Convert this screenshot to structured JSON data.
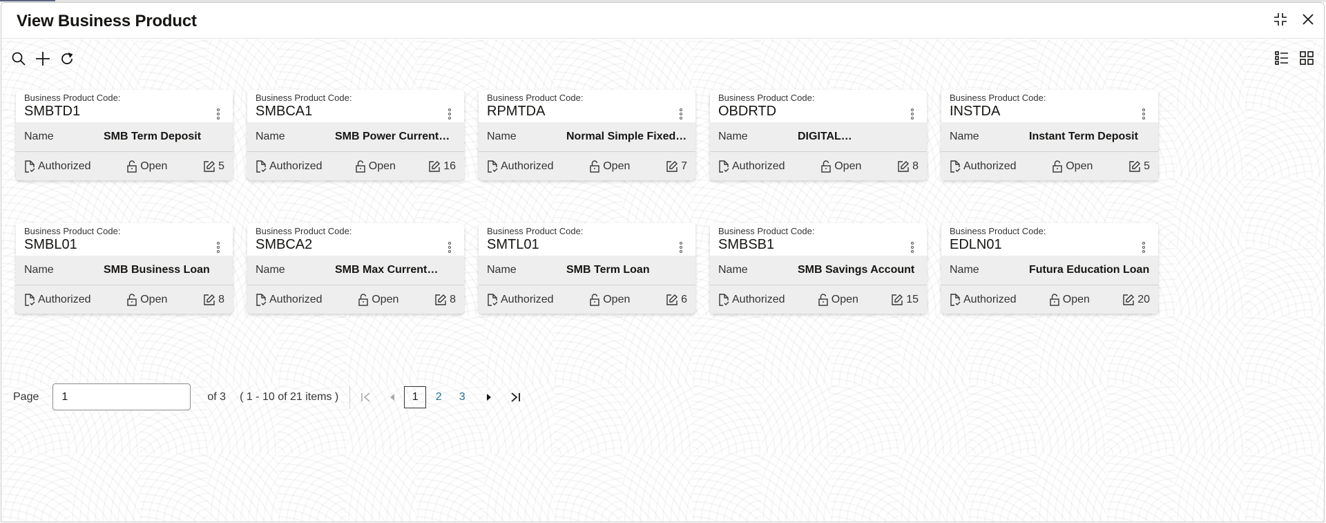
{
  "window": {
    "title": "View Business Product",
    "header_icons": [
      "minimize-icon",
      "close-icon"
    ]
  },
  "toolbar": {
    "icons": [
      "search-icon",
      "add-icon",
      "refresh-icon"
    ],
    "view_icons": [
      "list-view-icon",
      "tile-view-icon"
    ]
  },
  "cards": [
    {
      "code_label": "Business Product Code:",
      "code": "SMBTD1",
      "name_label": "Name",
      "name": "SMB Term Deposit",
      "auth_status": "Authorized",
      "record_status": "Open",
      "mod_count": "5"
    },
    {
      "code_label": "Business Product Code:",
      "code": "SMBCA1",
      "name_label": "Name",
      "name": "SMB Power Current…",
      "auth_status": "Authorized",
      "record_status": "Open",
      "mod_count": "16"
    },
    {
      "code_label": "Business Product Code:",
      "code": "RPMTDA",
      "name_label": "Name",
      "name": "Normal Simple Fixed…",
      "auth_status": "Authorized",
      "record_status": "Open",
      "mod_count": "7"
    },
    {
      "code_label": "Business Product Code:",
      "code": "OBDRTD",
      "name_label": "Name",
      "name": "DIGITAL…",
      "auth_status": "Authorized",
      "record_status": "Open",
      "mod_count": "8"
    },
    {
      "code_label": "Business Product Code:",
      "code": "INSTDA",
      "name_label": "Name",
      "name": "Instant Term Deposit",
      "auth_status": "Authorized",
      "record_status": "Open",
      "mod_count": "5"
    },
    {
      "code_label": "Business Product Code:",
      "code": "SMBL01",
      "name_label": "Name",
      "name": "SMB Business Loan",
      "auth_status": "Authorized",
      "record_status": "Open",
      "mod_count": "8"
    },
    {
      "code_label": "Business Product Code:",
      "code": "SMBCA2",
      "name_label": "Name",
      "name": "SMB Max Current…",
      "auth_status": "Authorized",
      "record_status": "Open",
      "mod_count": "8"
    },
    {
      "code_label": "Business Product Code:",
      "code": "SMTL01",
      "name_label": "Name",
      "name": "SMB Term Loan",
      "auth_status": "Authorized",
      "record_status": "Open",
      "mod_count": "6"
    },
    {
      "code_label": "Business Product Code:",
      "code": "SMBSB1",
      "name_label": "Name",
      "name": "SMB Savings Account",
      "auth_status": "Authorized",
      "record_status": "Open",
      "mod_count": "15"
    },
    {
      "code_label": "Business Product Code:",
      "code": "EDLN01",
      "name_label": "Name",
      "name": "Futura Education Loan",
      "auth_status": "Authorized",
      "record_status": "Open",
      "mod_count": "20"
    }
  ],
  "pagination": {
    "page_label": "Page",
    "page_value": "1",
    "of_text": "of 3",
    "range_text": "( 1 - 10 of 21 items )",
    "pages": [
      "1",
      "2",
      "3"
    ],
    "current_page": "1"
  },
  "colors": {
    "link": "#227298",
    "card_band": "#eeeeee",
    "tab_indicator": "#5b6283"
  }
}
